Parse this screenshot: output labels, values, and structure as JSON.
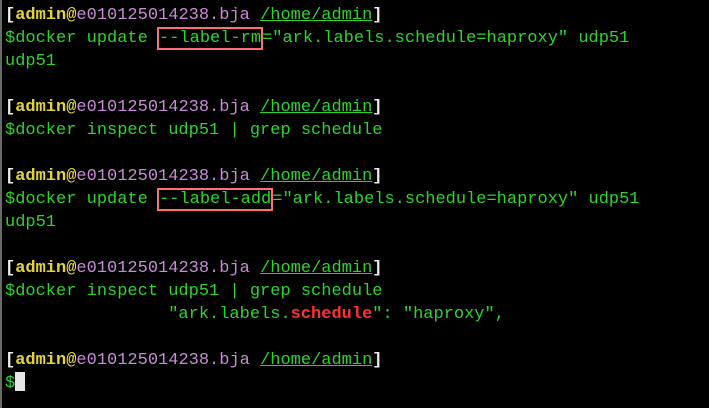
{
  "prompt": {
    "open": "[",
    "user": "admin",
    "at": "@",
    "host": "e010125014238.bja",
    "path": "/home/admin",
    "close": "]",
    "dollar": "$"
  },
  "commands": {
    "c1_pre": "docker update ",
    "c1_flag": "--label-rm",
    "c1_post": "=\"ark.labels.schedule=haproxy\" udp51",
    "c1_out": "udp51",
    "c2": "docker inspect udp51 | grep schedule",
    "c3_pre": "docker update ",
    "c3_flag": "--label-add",
    "c3_post": "=\"ark.labels.schedule=haproxy\" udp51",
    "c3_out": "udp51",
    "c4": "docker inspect udp51 | grep schedule",
    "c4_out_pre": "                \"ark.labels.",
    "c4_out_match": "schedule",
    "c4_out_post": "\": \"haproxy\","
  }
}
